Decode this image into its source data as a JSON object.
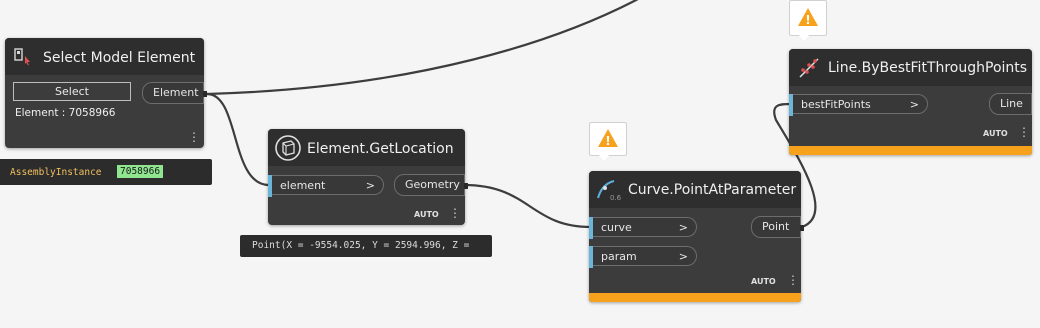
{
  "nodes": {
    "select_model_element": {
      "title": "Select Model Element",
      "button_label": "Select",
      "output_port": "Element",
      "status_text": "Element : 7058966",
      "preview": {
        "type_name": "AssemblyInstance",
        "id_value": "7058966"
      }
    },
    "element_get_location": {
      "title": "Element.GetLocation",
      "input_port": "element",
      "output_port": "Geometry",
      "lacing": "AUTO",
      "preview_text": "Point(X = -9554.025, Y = 2594.996, Z ="
    },
    "curve_point_at_parameter": {
      "title": "Curve.PointAtParameter",
      "input_ports": [
        "curve",
        "param"
      ],
      "output_port": "Point",
      "lacing": "AUTO",
      "icon_caption": "0.6"
    },
    "line_by_best_fit": {
      "title": "Line.ByBestFitThroughPoints",
      "input_port": "bestFitPoints",
      "output_port": "Line",
      "lacing": "AUTO"
    }
  },
  "port_arrow": ">",
  "menu_glyph": "⋮",
  "warning_glyph": "!",
  "colors": {
    "canvas": "#f5f5f5",
    "node_body": "#3c3c3c",
    "node_header": "#2e2e2e",
    "input_bar": "#6bb5d9",
    "warning": "#f7a21c",
    "preview_id_bg": "#8fe68f",
    "preview_type": "#f0c060"
  },
  "icons": [
    "select-model-element-icon",
    "element-get-location-icon",
    "curve-point-at-parameter-icon",
    "line-best-fit-icon",
    "warning-icon"
  ]
}
